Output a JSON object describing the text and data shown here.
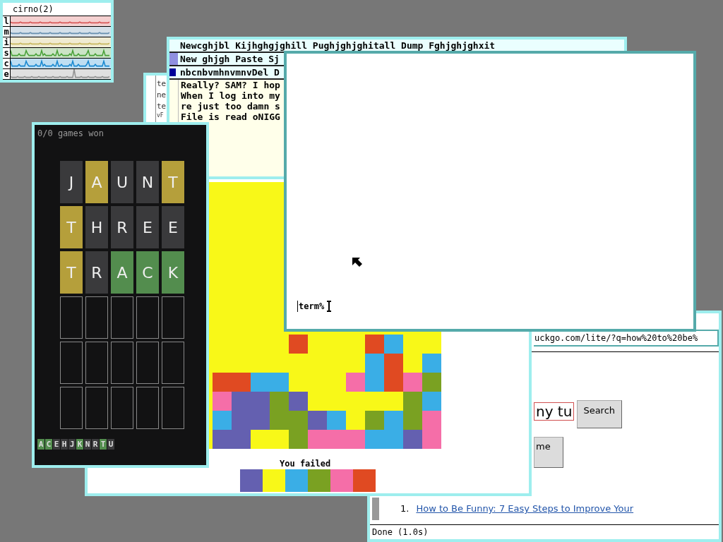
{
  "stats_window": {
    "title": "cirno(2)",
    "active": false,
    "meters": [
      {
        "label": "l",
        "kind": "flat",
        "color": "#d85858"
      },
      {
        "label": "m",
        "kind": "flat",
        "color": "#6890b0"
      },
      {
        "label": "i",
        "kind": "flat",
        "color": "#c8b860"
      },
      {
        "label": "s",
        "kind": "spiky",
        "color": "#48a038"
      },
      {
        "label": "c",
        "kind": "spiky",
        "color": "#1888d0"
      },
      {
        "label": "e",
        "kind": "spike",
        "color": "#909090"
      }
    ]
  },
  "small_window": {
    "active": false,
    "lines": [
      {
        "text": "te",
        "kind": "normal"
      },
      {
        "text": "ne",
        "kind": "normal"
      },
      {
        "text": "te",
        "kind": "normal"
      },
      {
        "text": "vF",
        "kind": "small"
      }
    ]
  },
  "sam_window": {
    "active": false,
    "menu_lines": [
      {
        "text": "Newcghjbl Kijhghgjghill Pughjghjghitall Dump Fghjghjghxit"
      },
      {
        "text": "New ghjgh Paste Sj",
        "color": "#9090e0"
      },
      {
        "text": "nbcnbvmhnvmnvDel D",
        "color": "#000099"
      }
    ],
    "body_lines": [
      "Really? SAM? I hop",
      "When I log into my",
      "re just too damn s",
      "File is read oNIGG"
    ]
  },
  "browser": {
    "active": false,
    "url": "uckgo.com/lite/?q=how%20to%20be%",
    "search_value": "ny tu",
    "search_button": "Search",
    "second_button": "me",
    "results": [
      {
        "number": "1.",
        "title": "How to Be Funny: 7 Easy Steps to Improve Your"
      }
    ],
    "status": "Done (1.0s)"
  },
  "tetris": {
    "active": false,
    "board": {
      "rows": [
        {
          "cells": [
            null,
            null,
            null,
            null,
            {
              "color": "#e04a22"
            },
            null,
            null,
            null,
            {
              "color": "#e04a22"
            },
            {
              "color": "#3aaee6"
            },
            null,
            null
          ]
        },
        {
          "cells": [
            null,
            null,
            null,
            null,
            null,
            null,
            null,
            null,
            {
              "color": "#3aaee6"
            },
            {
              "color": "#e04a22"
            },
            null,
            {
              "color": "#3aaee6"
            }
          ]
        },
        {
          "cells": [
            {
              "color": "#e04a22"
            },
            {
              "color": "#e04a22"
            },
            {
              "color": "#3aaee6"
            },
            {
              "color": "#3aaee6"
            },
            null,
            null,
            null,
            {
              "color": "#f56ea8"
            },
            {
              "color": "#3aaee6"
            },
            {
              "color": "#e04a22"
            },
            {
              "color": "#f56ea8"
            },
            {
              "color": "#7aa122"
            }
          ]
        },
        {
          "cells": [
            {
              "color": "#f56ea8"
            },
            {
              "color": "#6460b0"
            },
            {
              "color": "#6460b0"
            },
            {
              "color": "#7aa122"
            },
            {
              "color": "#6460b0"
            },
            null,
            null,
            null,
            null,
            null,
            {
              "color": "#7aa122"
            },
            {
              "color": "#3aaee6"
            }
          ]
        },
        {
          "cells": [
            {
              "color": "#3aaee6"
            },
            {
              "color": "#6460b0"
            },
            {
              "color": "#6460b0"
            },
            {
              "color": "#7aa122"
            },
            {
              "color": "#7aa122"
            },
            {
              "color": "#6460b0"
            },
            {
              "color": "#3aaee6"
            },
            null,
            {
              "color": "#7aa122"
            },
            {
              "color": "#3aaee6"
            },
            {
              "color": "#7aa122"
            },
            {
              "color": "#f56ea8"
            }
          ]
        },
        {
          "cells": [
            {
              "color": "#6460b0"
            },
            {
              "color": "#6460b0"
            },
            null,
            null,
            {
              "color": "#7aa122"
            },
            {
              "color": "#f56ea8"
            },
            {
              "color": "#f56ea8"
            },
            {
              "color": "#f56ea8"
            },
            {
              "color": "#3aaee6"
            },
            {
              "color": "#3aaee6"
            },
            {
              "color": "#6460b0"
            },
            {
              "color": "#f56ea8"
            }
          ]
        }
      ]
    },
    "message": "You failed",
    "next_pieces": [
      {
        "color": "#6460b0"
      },
      {
        "color": "#f8f818"
      },
      {
        "color": "#3aaee6"
      },
      {
        "color": "#7aa122"
      },
      {
        "color": "#f56ea8"
      },
      {
        "color": "#e04a22"
      }
    ]
  },
  "terminal": {
    "active": true,
    "prompt": "term%"
  },
  "wordle": {
    "active": false,
    "score": "0/0 games won",
    "rows": [
      {
        "tiles": [
          {
            "filled": true,
            "letter": "J",
            "color": "#3a3a3c"
          },
          {
            "filled": true,
            "letter": "A",
            "color": "#b59f3b"
          },
          {
            "filled": true,
            "letter": "U",
            "color": "#3a3a3c"
          },
          {
            "filled": true,
            "letter": "N",
            "color": "#3a3a3c"
          },
          {
            "filled": true,
            "letter": "T",
            "color": "#b59f3b"
          }
        ]
      },
      {
        "tiles": [
          {
            "filled": true,
            "letter": "T",
            "color": "#b59f3b"
          },
          {
            "filled": true,
            "letter": "H",
            "color": "#3a3a3c"
          },
          {
            "filled": true,
            "letter": "R",
            "color": "#3a3a3c"
          },
          {
            "filled": true,
            "letter": "E",
            "color": "#3a3a3c"
          },
          {
            "filled": true,
            "letter": "E",
            "color": "#3a3a3c"
          }
        ]
      },
      {
        "tiles": [
          {
            "filled": true,
            "letter": "T",
            "color": "#b59f3b"
          },
          {
            "filled": true,
            "letter": "R",
            "color": "#3a3a3c"
          },
          {
            "filled": true,
            "letter": "A",
            "color": "#538d4e"
          },
          {
            "filled": true,
            "letter": "C",
            "color": "#538d4e"
          },
          {
            "filled": true,
            "letter": "K",
            "color": "#538d4e"
          }
        ]
      },
      {
        "tiles": [
          {
            "filled": false
          },
          {
            "filled": false
          },
          {
            "filled": false
          },
          {
            "filled": false
          },
          {
            "filled": false
          }
        ]
      },
      {
        "tiles": [
          {
            "filled": false
          },
          {
            "filled": false
          },
          {
            "filled": false
          },
          {
            "filled": false
          },
          {
            "filled": false
          }
        ]
      },
      {
        "tiles": [
          {
            "filled": false
          },
          {
            "filled": false
          },
          {
            "filled": false
          },
          {
            "filled": false
          },
          {
            "filled": false
          }
        ]
      }
    ],
    "keys": [
      {
        "letter": "A",
        "color": "#538d4e"
      },
      {
        "letter": "C",
        "color": "#538d4e"
      },
      {
        "letter": "E",
        "color": "#3a3a3c"
      },
      {
        "letter": "H",
        "color": "#3a3a3c"
      },
      {
        "letter": "J",
        "color": "#3a3a3c"
      },
      {
        "letter": "K",
        "color": "#538d4e"
      },
      {
        "letter": "N",
        "color": "#3a3a3c"
      },
      {
        "letter": "R",
        "color": "#3a3a3c"
      },
      {
        "letter": "T",
        "color": "#538d4e"
      },
      {
        "letter": "U",
        "color": "#3a3a3c"
      }
    ]
  }
}
